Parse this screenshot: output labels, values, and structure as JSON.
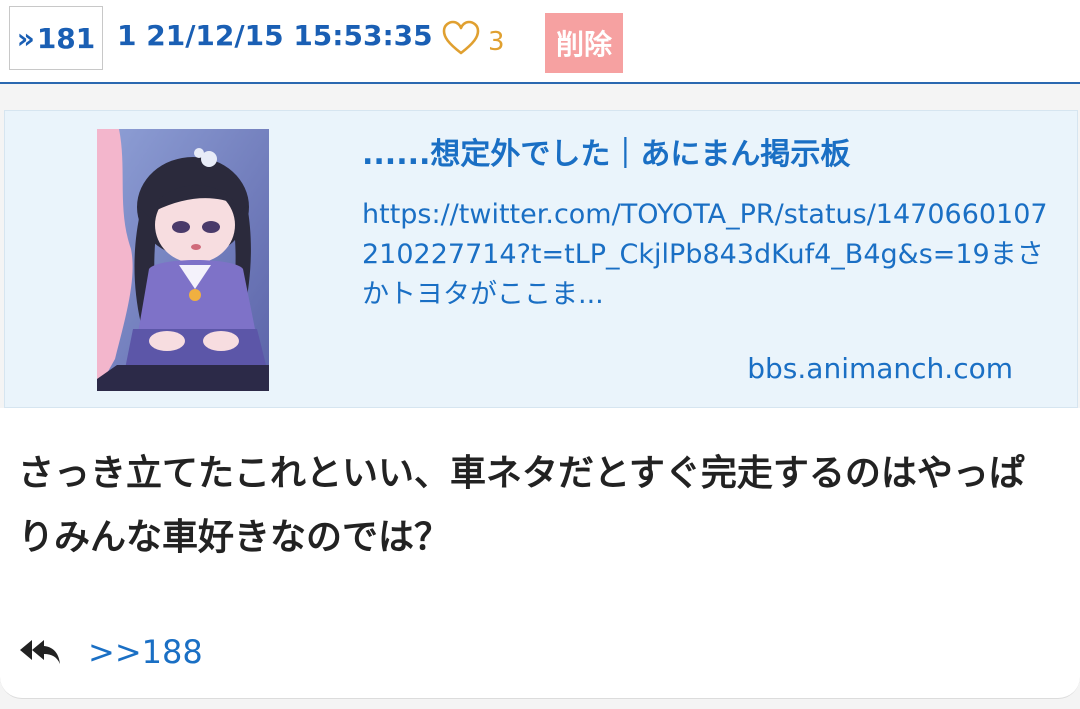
{
  "header": {
    "res_link": "181",
    "meta": "1 21/12/15 15:53:35",
    "like_count": "3",
    "delete_label": "削除"
  },
  "link_card": {
    "title": "......想定外でした｜あにまん掲示板",
    "description": "https://twitter.com/TOYOTA_PR/status/1470660107210227714?t=tLP_CkjlPb843dKuf4_B4g&s=19まさかトヨタがここま...",
    "domain": "bbs.animanch.com"
  },
  "post": {
    "message": "さっき立てたこれといい、車ネタだとすぐ完走するのはやっぱりみんな車好きなのでは？",
    "reply_link": ">>188"
  },
  "colors": {
    "accent": "#1a5fb4",
    "link": "#1a6fc4",
    "like": "#e0a030",
    "delete_bg": "#f6a1a1",
    "card_bg": "#eaf4fb"
  }
}
